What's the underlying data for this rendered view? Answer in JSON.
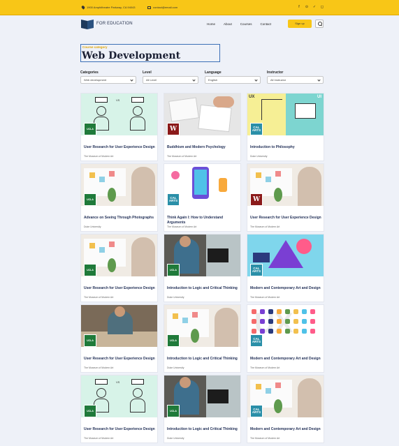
{
  "topbar": {
    "address": "1900 Amphitheatre Parkway, CA 94043",
    "email": "contact@email.com",
    "social_icons": [
      "facebook-icon",
      "pinterest-icon",
      "twitter-icon",
      "instagram-icon"
    ]
  },
  "header": {
    "logo_text": "FOR EDUCATION",
    "nav": [
      "Home",
      "About",
      "Courses",
      "Contact"
    ],
    "signup_label": "Sign up"
  },
  "page": {
    "kicker": "Course category",
    "title": "Web Development"
  },
  "filters": [
    {
      "label": "Categories",
      "value": "Web development"
    },
    {
      "label": "Level",
      "value": "All Level"
    },
    {
      "label": "Language",
      "value": "English"
    },
    {
      "label": "Instructor",
      "value": "All Instructor"
    }
  ],
  "courses": [
    {
      "title": "User Research for User Experience Design",
      "institution": "The Museum of Modern Art",
      "thumb": "mint",
      "badge": "ucla"
    },
    {
      "title": "Buddhism and Modern Psychology",
      "institution": "The Museum of Modern Art",
      "thumb": "sketch",
      "badge": "w"
    },
    {
      "title": "Introduction to Philosophy",
      "institution": "Duke University",
      "thumb": "philo",
      "badge": "cal"
    },
    {
      "title": "Advance on Seeing Through Photographs",
      "institution": "Duke University",
      "thumb": "write",
      "badge": "ucla"
    },
    {
      "title": "Think Again I: How to Understand Arguments",
      "institution": "The Museum of Modern Art",
      "thumb": "app",
      "badge": "cal"
    },
    {
      "title": "User Research for User Experience Design",
      "institution": "The Museum of Modern Art",
      "thumb": "write",
      "badge": "w"
    },
    {
      "title": "User Research for User Experience Design",
      "institution": "The Museum of Modern Art",
      "thumb": "write",
      "badge": "ucla"
    },
    {
      "title": "Introduction to Logic and Critical Thinking",
      "institution": "Duke University",
      "thumb": "desk",
      "badge": "ucla"
    },
    {
      "title": "Modern and Contemporary Art and Design",
      "institution": "The Museum of Modern Art",
      "thumb": "art",
      "badge": "cal"
    },
    {
      "title": "User Research for User Experience Design",
      "institution": "The Museum of Modern Art",
      "thumb": "warm",
      "badge": "ucla"
    },
    {
      "title": "Introduction to Logic and Critical Thinking",
      "institution": "Duke University",
      "thumb": "write",
      "badge": "ucla"
    },
    {
      "title": "Modern and Contemporary Art and Design",
      "institution": "The Museum of Modern Art",
      "thumb": "colors",
      "badge": "cal"
    },
    {
      "title": "User Research for User Experience Design",
      "institution": "The Museum of Modern Art",
      "thumb": "mint",
      "badge": "ucla"
    },
    {
      "title": "Introduction to Logic and Critical Thinking",
      "institution": "Duke University",
      "thumb": "desk",
      "badge": "ucla"
    },
    {
      "title": "Modern and Contemporary Art and Design",
      "institution": "The Museum of Modern Art",
      "thumb": "write",
      "badge": "cal"
    }
  ],
  "badge_text": {
    "ucla": "UCLA",
    "w": "W",
    "cal": "CAL ARTS"
  },
  "colors": {
    "accent": "#f8c617",
    "title": "#1f2d55",
    "background": "#eef1f8"
  }
}
